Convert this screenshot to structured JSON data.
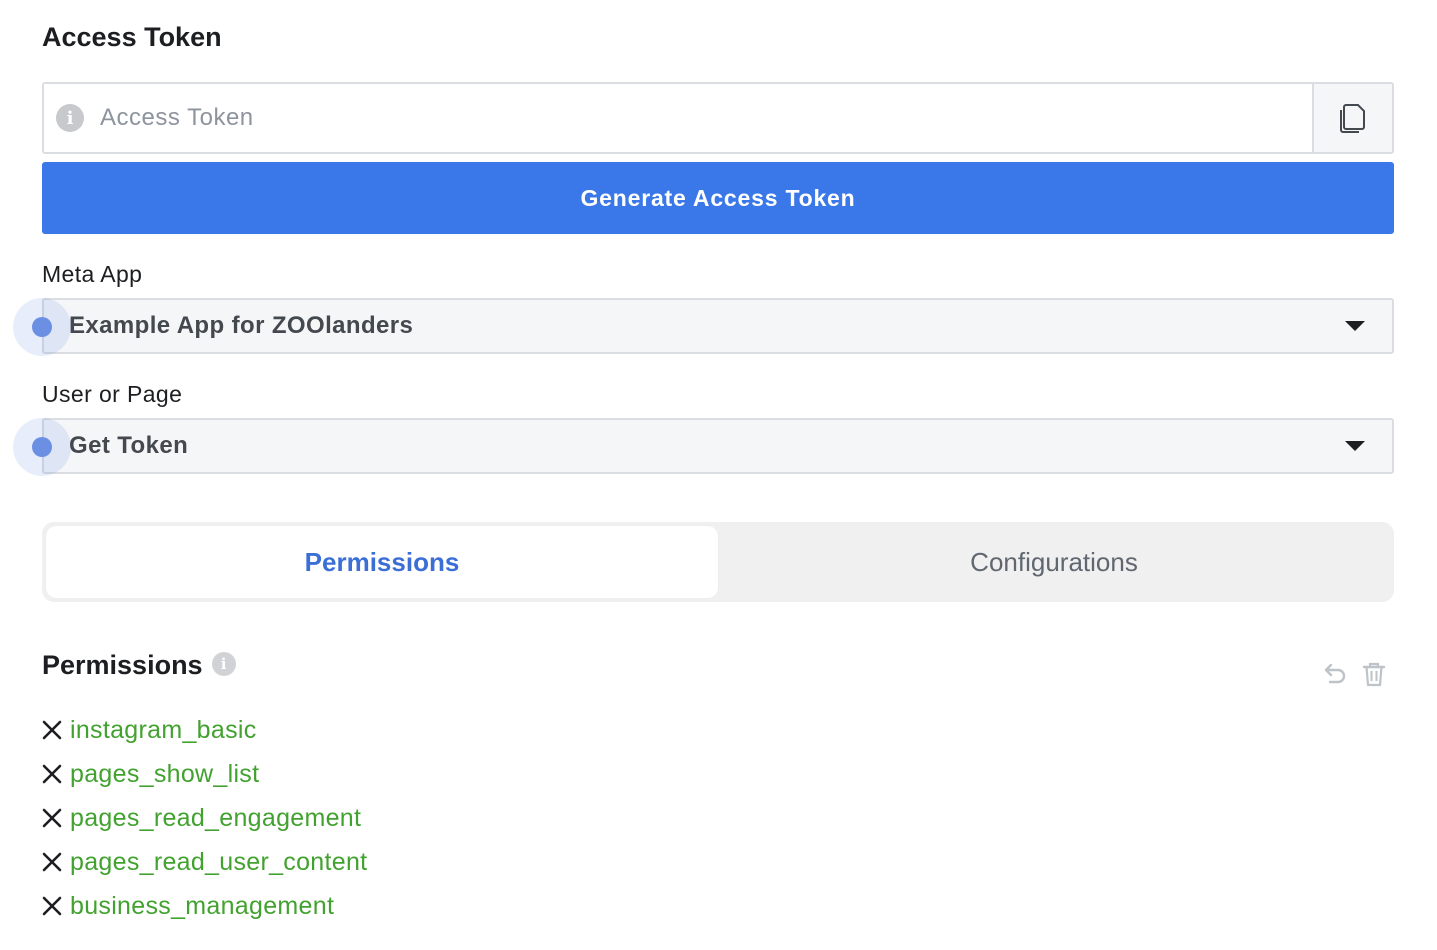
{
  "access_token": {
    "title": "Access Token",
    "input_placeholder": "Access Token",
    "input_value": "",
    "info_icon": "info-icon",
    "copy_icon": "copy-icon",
    "generate_label": "Generate Access Token"
  },
  "meta_app": {
    "label": "Meta App",
    "selected": "Example App for ZOOlanders"
  },
  "user_or_page": {
    "label": "User or Page",
    "selected": "Get Token"
  },
  "tabs": [
    {
      "label": "Permissions",
      "active": true
    },
    {
      "label": "Configurations",
      "active": false
    }
  ],
  "permissions": {
    "title": "Permissions",
    "items": [
      "instagram_basic",
      "pages_show_list",
      "pages_read_engagement",
      "pages_read_user_content",
      "business_management"
    ],
    "undo_icon": "undo-icon",
    "trash_icon": "trash-icon"
  },
  "colors": {
    "primary": "#3a77e8",
    "permission_text": "#42a22f",
    "active_tab": "#3b6fd6"
  }
}
